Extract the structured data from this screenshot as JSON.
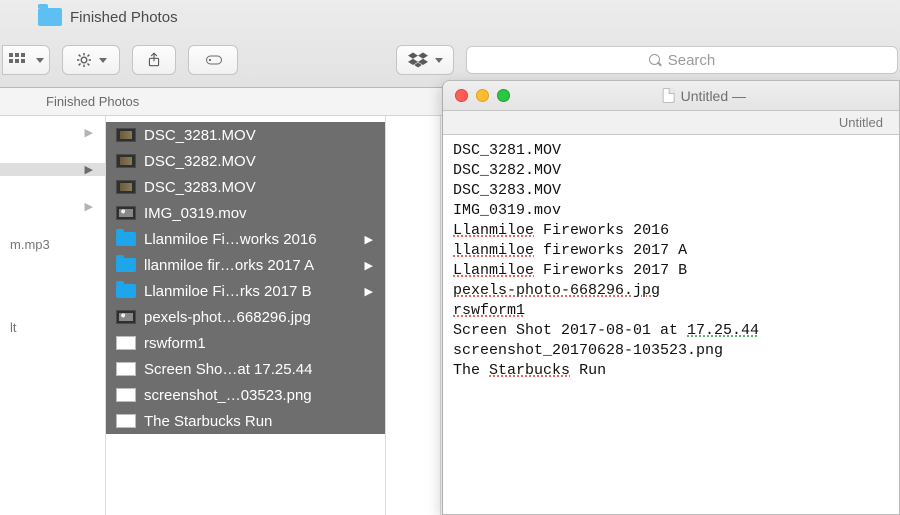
{
  "finder": {
    "window_title": "Finished Photos",
    "subheader": "Finished Photos",
    "toolbar": {
      "search_placeholder": "Search"
    },
    "col1": {
      "item2": "m.mp3",
      "item3": "lt"
    },
    "files": [
      {
        "name": "DSC_3281.MOV",
        "kind": "video",
        "folder": false
      },
      {
        "name": "DSC_3282.MOV",
        "kind": "video",
        "folder": false
      },
      {
        "name": "DSC_3283.MOV",
        "kind": "video",
        "folder": false
      },
      {
        "name": "IMG_0319.mov",
        "kind": "img",
        "folder": false
      },
      {
        "name": "Llanmiloe Fi…works 2016",
        "kind": "",
        "folder": true
      },
      {
        "name": "llanmiloe fir…orks 2017 A",
        "kind": "",
        "folder": true
      },
      {
        "name": "Llanmiloe Fi…rks 2017 B",
        "kind": "",
        "folder": true
      },
      {
        "name": "pexels-phot…668296.jpg",
        "kind": "img",
        "folder": false
      },
      {
        "name": "rswform1",
        "kind": "doc",
        "folder": false
      },
      {
        "name": "Screen Sho…at 17.25.44",
        "kind": "doc",
        "folder": false
      },
      {
        "name": "screenshot_…03523.png",
        "kind": "doc",
        "folder": false
      },
      {
        "name": "The Starbucks Run",
        "kind": "doc",
        "folder": false
      }
    ]
  },
  "textedit": {
    "title": "Untitled —",
    "tab": "Untitled",
    "lines": [
      "DSC_3281.MOV",
      "DSC_3282.MOV",
      "DSC_3283.MOV",
      "IMG_0319.mov",
      "Llanmiloe Fireworks 2016",
      "llanmiloe fireworks 2017 A",
      "Llanmiloe Fireworks 2017 B",
      "pexels-photo-668296.jpg",
      "rswform1",
      "Screen Shot 2017-08-01 at 17.25.44",
      "screenshot_20170628-103523.png",
      "The Starbucks Run"
    ]
  }
}
